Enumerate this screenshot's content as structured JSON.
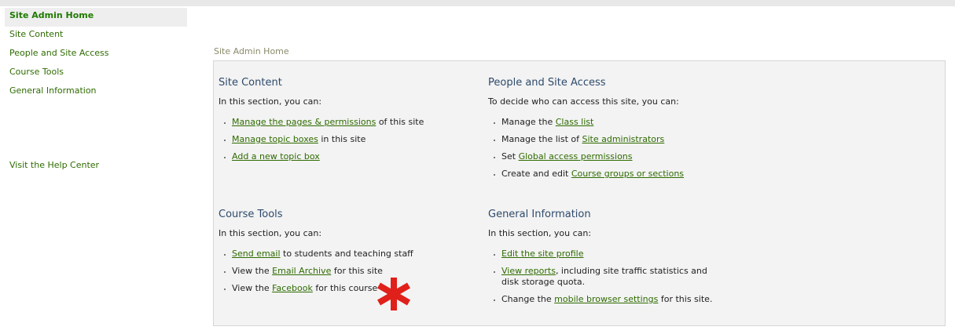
{
  "sidebar": {
    "items": [
      {
        "label": "Site Admin Home",
        "active": true
      },
      {
        "label": "Site Content"
      },
      {
        "label": "People and Site Access"
      },
      {
        "label": "Course Tools"
      },
      {
        "label": "General Information"
      }
    ],
    "help": "Visit the Help Center"
  },
  "breadcrumb": "Site Admin Home",
  "sections": {
    "site_content": {
      "title": "Site Content",
      "intro": "In this section, you can:",
      "items": [
        {
          "link": "Manage the pages & permissions",
          "post": " of this site"
        },
        {
          "link": "Manage topic boxes",
          "post": " in this site"
        },
        {
          "link": "Add a new topic box"
        }
      ]
    },
    "people": {
      "title": "People and Site Access",
      "intro": "To decide who can access this site, you can:",
      "items": [
        {
          "pre": "Manage the ",
          "link": "Class list"
        },
        {
          "pre": "Manage the list of ",
          "link": "Site administrators"
        },
        {
          "pre": "Set ",
          "link": "Global access permissions"
        },
        {
          "pre": "Create and edit ",
          "link": "Course groups or sections"
        }
      ]
    },
    "course_tools": {
      "title": "Course Tools",
      "intro": "In this section, you can:",
      "items": [
        {
          "link": "Send email",
          "post": " to students and teaching staff"
        },
        {
          "pre": "View the ",
          "link": "Email Archive",
          "post": " for this site"
        },
        {
          "pre": "View the ",
          "link": "Facebook",
          "post": " for this course"
        }
      ]
    },
    "general_info": {
      "title": "General Information",
      "intro": "In this section, you can:",
      "items": [
        {
          "link": "Edit the site profile"
        },
        {
          "link": "View reports",
          "post": ", including site traffic statistics and disk storage quota."
        },
        {
          "pre": "Change the ",
          "link": "mobile browser settings",
          "post": " for this site."
        }
      ]
    }
  },
  "colors": {
    "link": "#2e6b00",
    "heading": "#2d4a6b",
    "panel_bg": "#f3f3f3",
    "asterisk": "#e0201a"
  }
}
